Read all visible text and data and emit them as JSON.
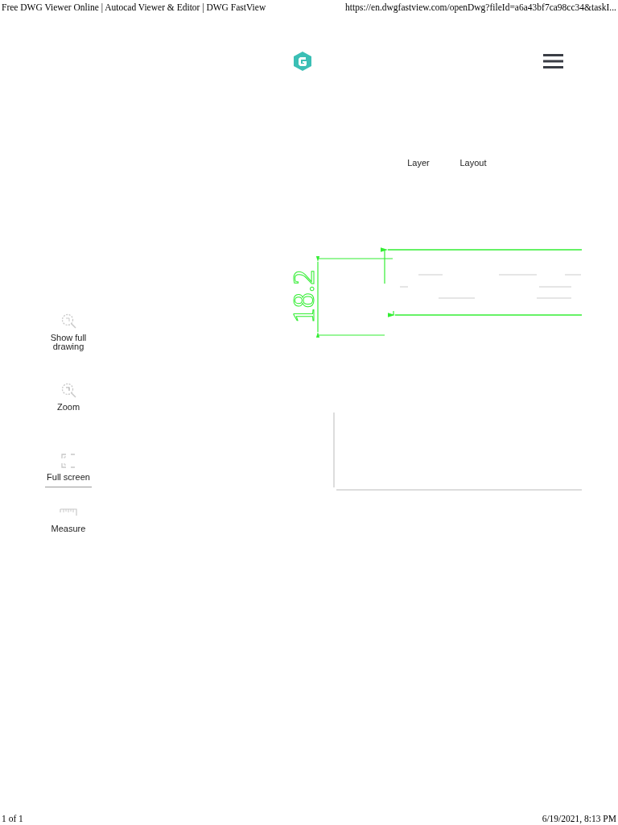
{
  "print_header": {
    "title": "Free DWG Viewer Online | Autocad Viewer & Editor | DWG FastView",
    "url": "https://en.dwgfastview.com/openDwg?fileId=a6a43bf7ca98cc34&taskI..."
  },
  "tabs": [
    {
      "label": "Layer"
    },
    {
      "label": "Layout"
    }
  ],
  "tools": [
    {
      "kind": "fit",
      "label": "Show full drawing",
      "separated": false
    },
    {
      "kind": "zoom",
      "label": "Zoom",
      "separated": false
    },
    {
      "kind": "fullscreen",
      "label": "Full screen",
      "separated": false
    },
    {
      "kind": "measure",
      "label": "Measure",
      "separated": true
    }
  ],
  "drawing": {
    "dimension": "18.2"
  },
  "print_footer": {
    "page": "1 of 1",
    "date": "6/19/2021, 8:13 PM"
  }
}
